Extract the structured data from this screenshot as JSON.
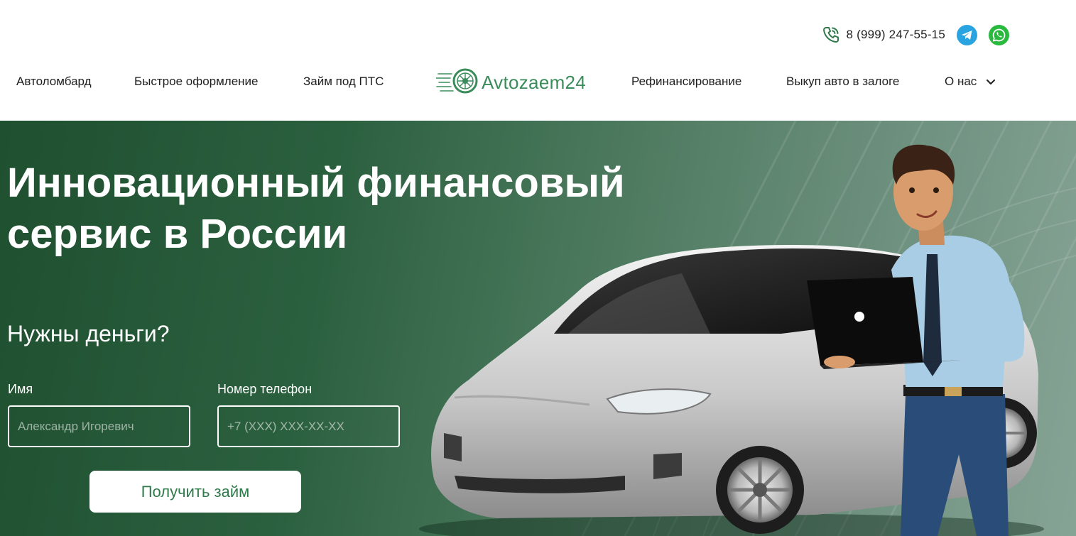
{
  "header": {
    "phone": "8 (999) 247-55-15",
    "logo_text": "Avtozaem24",
    "nav_left": [
      "Автоломбард",
      "Быстрое оформление",
      "Займ под ПТС"
    ],
    "nav_right": [
      "Рефинансирование",
      "Выкуп авто в залоге",
      "О нас"
    ],
    "icons": {
      "phone": "phone-icon",
      "telegram": "telegram-icon",
      "whatsapp": "whatsapp-icon",
      "dropdown": "chevron-down-icon",
      "logo": "wheel-logo-icon"
    }
  },
  "hero": {
    "title_line1": "Инновационный финансовый",
    "title_line2": "сервис в России",
    "subtitle": "Нужны деньги?",
    "form": {
      "name_label": "Имя",
      "name_placeholder": "Александр Игоревич",
      "phone_label": "Номер телефон",
      "phone_placeholder": "+7 (XXX) XXX-XX-XX",
      "submit_label": "Получить займ"
    }
  },
  "colors": {
    "brand_green": "#3a8d5a",
    "hero_dark": "#1f5030",
    "telegram": "#2aa3e1",
    "whatsapp": "#29b93f"
  }
}
